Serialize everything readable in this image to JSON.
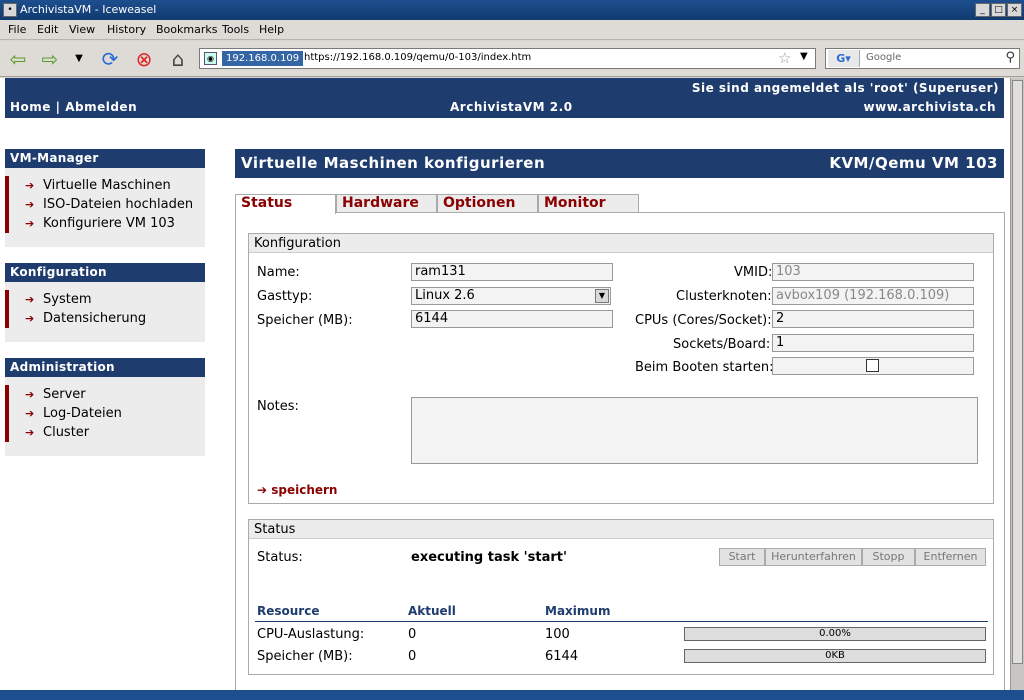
{
  "window": {
    "title": "ArchivistaVM - Iceweasel"
  },
  "menu": [
    "File",
    "Edit",
    "View",
    "History",
    "Bookmarks",
    "Tools",
    "Help"
  ],
  "nav": {
    "site_id": "192.168.0.109",
    "url": "https://192.168.0.109/qemu/0-103/index.htm",
    "search_placeholder": "Google"
  },
  "header": {
    "logged_in": "Sie sind angemeldet als 'root' (Superuser)",
    "home": "Home",
    "sep": "|",
    "logout": "Abmelden",
    "app": "ArchivistaVM 2.0",
    "site": "www.archivista.ch"
  },
  "sidebar": [
    {
      "title": "VM-Manager",
      "items": [
        "Virtuelle Maschinen",
        "ISO-Dateien hochladen",
        "Konfiguriere VM 103"
      ]
    },
    {
      "title": "Konfiguration",
      "items": [
        "System",
        "Datensicherung"
      ]
    },
    {
      "title": "Administration",
      "items": [
        "Server",
        "Log-Dateien",
        "Cluster"
      ]
    }
  ],
  "main": {
    "title": "Virtuelle Maschinen konfigurieren",
    "vm": "KVM/Qemu VM 103",
    "tabs": [
      "Status",
      "Hardware",
      "Optionen",
      "Monitor"
    ]
  },
  "config": {
    "legend": "Konfiguration",
    "name_label": "Name:",
    "name": "ram131",
    "guest_label": "Gasttyp:",
    "guest": "Linux 2.6",
    "mem_label": "Speicher (MB):",
    "mem": "6144",
    "vmid_label": "VMID:",
    "vmid": "103",
    "node_label": "Clusterknoten:",
    "node": "avbox109 (192.168.0.109)",
    "cpus_label": "CPUs (Cores/Socket):",
    "cpus": "2",
    "sockets_label": "Sockets/Board:",
    "sockets": "1",
    "boot_label": "Beim Booten starten:",
    "notes_label": "Notes:",
    "save": "speichern"
  },
  "status": {
    "legend": "Status",
    "status_label": "Status:",
    "status_value": "executing task 'start'",
    "buttons": [
      "Start",
      "Herunterfahren",
      "Stopp",
      "Entfernen"
    ],
    "headers": [
      "Resource",
      "Aktuell",
      "Maximum"
    ],
    "rows": [
      {
        "resource": "CPU-Auslastung:",
        "current": "0",
        "max": "100",
        "bar": "0.00%"
      },
      {
        "resource": "Speicher (MB):",
        "current": "0",
        "max": "6144",
        "bar": "0KB"
      }
    ]
  }
}
